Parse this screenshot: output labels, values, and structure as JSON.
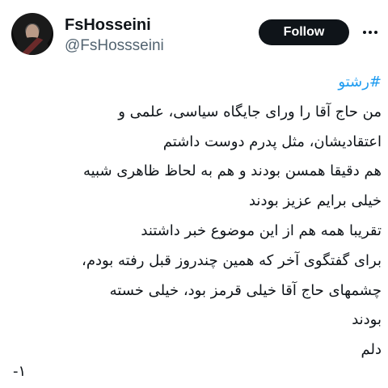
{
  "author": {
    "display_name": "FsHosseini",
    "handle": "@FsHossseini"
  },
  "actions": {
    "follow_label": "Follow",
    "more_icon": "more-dots-icon"
  },
  "colors": {
    "hashtag": "#1d9bf0",
    "follow_button_bg": "#0f1419",
    "handle_text": "#536471"
  },
  "tweet": {
    "hashtag": "#رشتو",
    "lines": [
      "من حاج آقا را ورای جایگاه سیاسی، علمی و",
      "اعتقادیشان، مثل پدرم دوست داشتم",
      "هم دقیقا همسن بودند و هم به لحاظ ظاهری شبیه",
      "خیلی برایم عزیز بودند",
      "تقریبا همه هم از این موضوع خبر داشتند",
      "برای گفتگوی آخر که همین چندروز قبل رفته بودم،",
      "چشمهای حاج آقا خیلی قرمز بود، خیلی خسته",
      "بودند",
      "دلم"
    ],
    "footer_number": "۱-"
  }
}
